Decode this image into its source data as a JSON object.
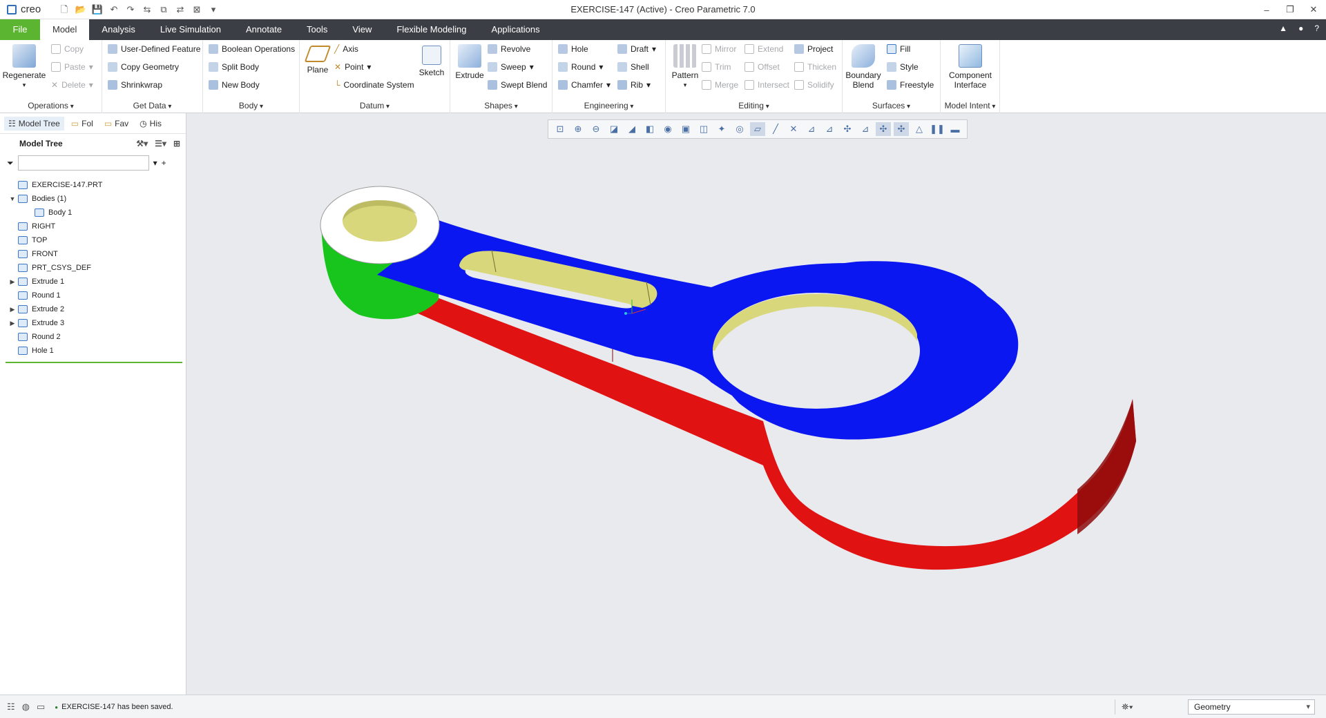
{
  "app": {
    "logo": "creo",
    "window_title": "EXERCISE-147 (Active) - Creo Parametric 7.0",
    "window_controls": [
      "–",
      "❐",
      "✕"
    ]
  },
  "tabs": [
    {
      "label": "File"
    },
    {
      "label": "Model",
      "active": true
    },
    {
      "label": "Analysis"
    },
    {
      "label": "Live Simulation"
    },
    {
      "label": "Annotate"
    },
    {
      "label": "Tools"
    },
    {
      "label": "View"
    },
    {
      "label": "Flexible Modeling"
    },
    {
      "label": "Applications"
    }
  ],
  "ribbon": {
    "operations": {
      "label": "Operations",
      "regenerate": "Regenerate",
      "copy": "Copy",
      "paste": "Paste",
      "delete": "Delete"
    },
    "get_data": {
      "label": "Get Data",
      "udf": "User-Defined Feature",
      "copy_geometry": "Copy Geometry",
      "shrinkwrap": "Shrinkwrap"
    },
    "body": {
      "label": "Body",
      "boolean": "Boolean Operations",
      "split": "Split Body",
      "new": "New Body"
    },
    "datum": {
      "label": "Datum",
      "plane": "Plane",
      "axis": "Axis",
      "point": "Point",
      "csys": "Coordinate System",
      "sketch": "Sketch"
    },
    "shapes": {
      "label": "Shapes",
      "extrude": "Extrude",
      "revolve": "Revolve",
      "sweep": "Sweep",
      "swept_blend": "Swept Blend"
    },
    "engineering": {
      "label": "Engineering",
      "hole": "Hole",
      "round": "Round",
      "chamfer": "Chamfer",
      "draft": "Draft",
      "shell": "Shell",
      "rib": "Rib"
    },
    "editing": {
      "label": "Editing",
      "pattern": "Pattern",
      "mirror": "Mirror",
      "trim": "Trim",
      "merge": "Merge",
      "extend": "Extend",
      "offset": "Offset",
      "intersect": "Intersect",
      "project": "Project",
      "thicken": "Thicken",
      "solidify": "Solidify"
    },
    "surfaces": {
      "label": "Surfaces",
      "boundary_blend_1": "Boundary",
      "boundary_blend_2": "Blend",
      "fill": "Fill",
      "style": "Style",
      "freestyle": "Freestyle"
    },
    "model_intent": {
      "label": "Model Intent",
      "component_1": "Component",
      "component_2": "Interface"
    }
  },
  "sidebar": {
    "tabs": [
      {
        "label": "Model Tree"
      },
      {
        "label": "Fol"
      },
      {
        "label": "Fav"
      },
      {
        "label": "His"
      }
    ],
    "header": "Model Tree",
    "search_placeholder": "",
    "tree": [
      {
        "label": "EXERCISE-147.PRT",
        "indent": 0,
        "toggle": ""
      },
      {
        "label": "Bodies (1)",
        "indent": 0,
        "toggle": "▼"
      },
      {
        "label": "Body 1",
        "indent": 1,
        "toggle": ""
      },
      {
        "label": "RIGHT",
        "indent": 0,
        "toggle": ""
      },
      {
        "label": "TOP",
        "indent": 0,
        "toggle": ""
      },
      {
        "label": "FRONT",
        "indent": 0,
        "toggle": ""
      },
      {
        "label": "PRT_CSYS_DEF",
        "indent": 0,
        "toggle": ""
      },
      {
        "label": "Extrude 1",
        "indent": 0,
        "toggle": "▶"
      },
      {
        "label": "Round 1",
        "indent": 0,
        "toggle": ""
      },
      {
        "label": "Extrude 2",
        "indent": 0,
        "toggle": "▶"
      },
      {
        "label": "Extrude 3",
        "indent": 0,
        "toggle": "▶"
      },
      {
        "label": "Round 2",
        "indent": 0,
        "toggle": ""
      },
      {
        "label": "Hole 1",
        "indent": 0,
        "toggle": ""
      }
    ]
  },
  "status": {
    "message": "EXERCISE-147 has been saved.",
    "filter": "Geometry"
  },
  "colors": {
    "file_tab": "#5cb531",
    "tabbar": "#3b3f45",
    "part_top": "#0a17f0",
    "part_side": "#e01212",
    "boss_side": "#17c51d",
    "hole_wall": "#d9d77b"
  }
}
